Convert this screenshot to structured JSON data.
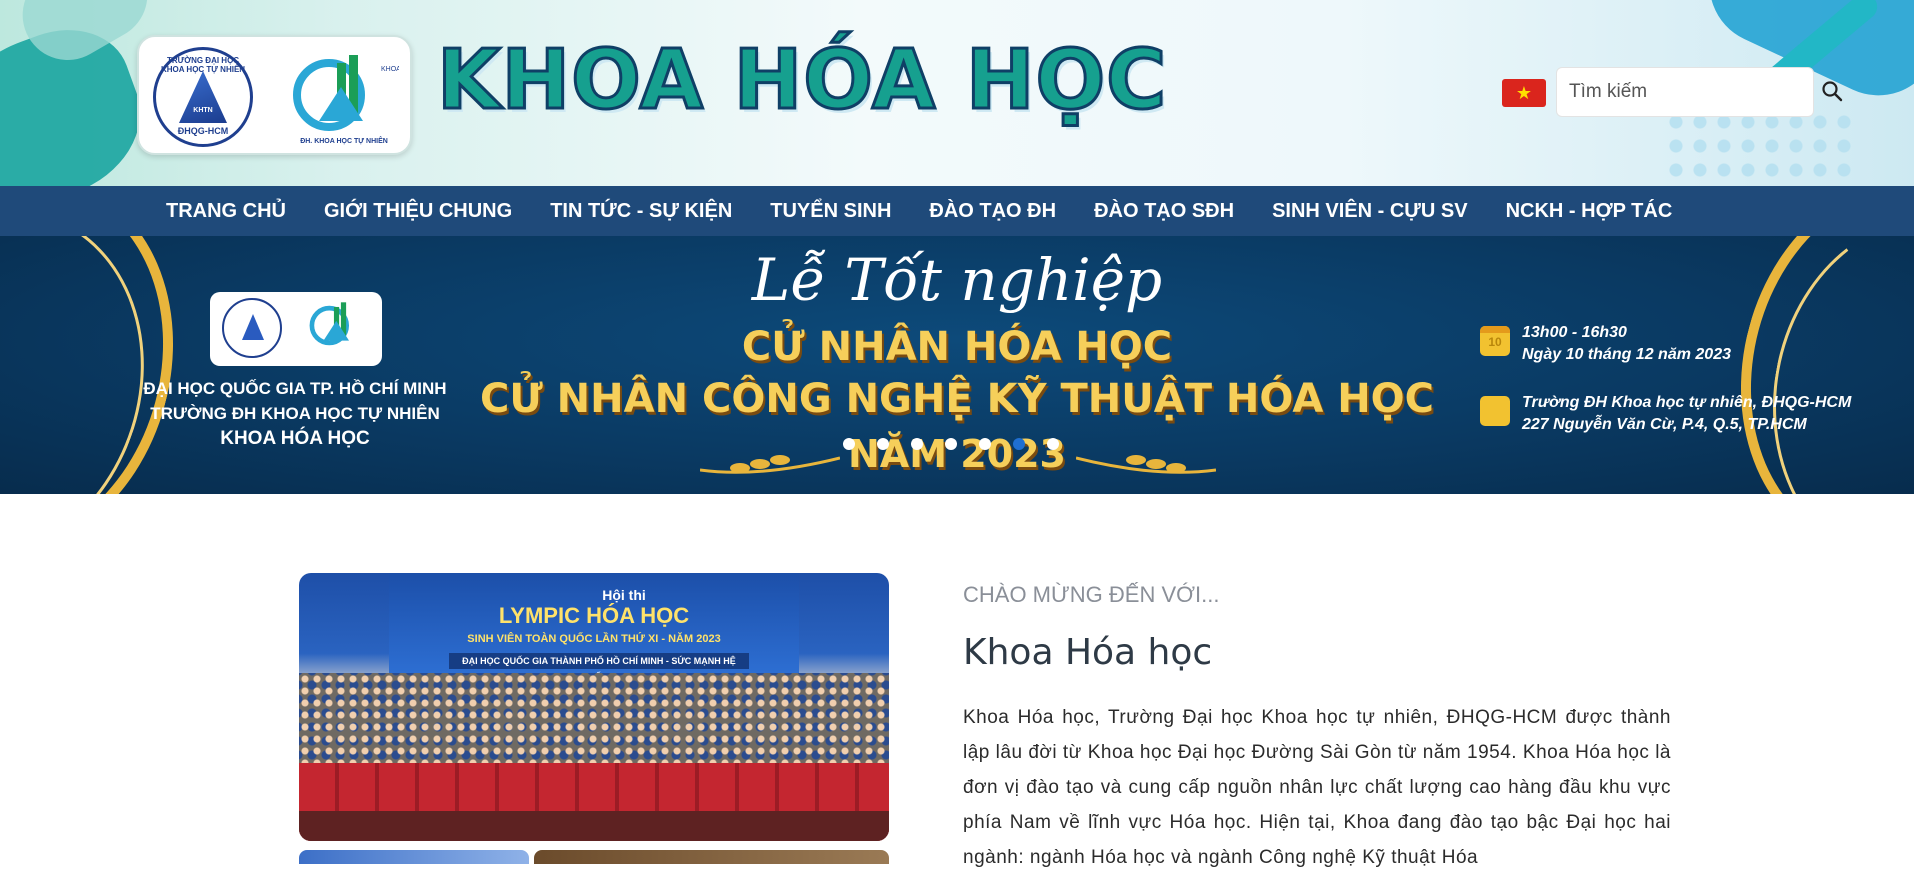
{
  "header": {
    "logo_seal_top": "TRƯỜNG ĐẠI HỌC KHOA HỌC TỰ NHIÊN",
    "logo_seal_mid": "KHTN",
    "logo_seal_bottom": "ĐHQG-HCM",
    "logo_mark_caption": "ĐH. KHOA HỌC TỰ NHIÊN",
    "site_title": "KHOA HÓA HỌC",
    "search_placeholder": "Tìm kiếm"
  },
  "nav": {
    "items": [
      {
        "label": "TRANG CHỦ"
      },
      {
        "label": "GIỚI THIỆU CHUNG"
      },
      {
        "label": "TIN TỨC - SỰ KIỆN"
      },
      {
        "label": "TUYỂN SINH"
      },
      {
        "label": "ĐÀO TẠO ĐH"
      },
      {
        "label": "ĐÀO TẠO SĐH"
      },
      {
        "label": "SINH VIÊN - CỰU SV"
      },
      {
        "label": "NCKH - HỢP TÁC"
      }
    ]
  },
  "banner": {
    "org_line1": "ĐẠI HỌC QUỐC GIA TP. HỒ CHÍ MINH",
    "org_line2": "TRƯỜNG ĐH KHOA HỌC TỰ NHIÊN",
    "org_line3": "KHOA HÓA HỌC",
    "script_title": "Lễ Tốt nghiệp",
    "line1": "CỬ NHÂN HÓA HỌC",
    "line2": "CỬ NHÂN CÔNG NGHỆ KỸ THUẬT HÓA HỌC",
    "line3": "NĂM 2023",
    "calendar_day": "10",
    "time": "13h00 - 16h30",
    "date": "Ngày 10 tháng 12 năm 2023",
    "place_line1": "Trường ĐH Khoa học tự nhiên, ĐHQG-HCM",
    "place_line2": "227 Nguyễn Văn Cừ, P.4, Q.5, TP.HCM",
    "slide_count": 7,
    "active_slide": 6
  },
  "photo": {
    "title_small": "Hội thi",
    "title_big": "LYMPIC HÓA HỌC",
    "subtitle": "SINH VIÊN TOÀN QUỐC LẦN THỨ XI - NĂM 2023",
    "strip": "ĐẠI HỌC QUỐC GIA THÀNH PHỐ HỒ CHÍ MINH - SỨC MẠNH HỆ THỐNG"
  },
  "welcome": {
    "eyebrow": "CHÀO MỪNG ĐẾN VỚI...",
    "heading": "Khoa Hóa học",
    "body": "Khoa Hóa học, Trường Đại học Khoa học tự nhiên, ĐHQG-HCM được thành lập lâu đời từ Khoa học Đại học Đường Sài Gòn từ năm 1954. Khoa Hóa học là đơn vị đào tạo và cung cấp nguồn nhân lực chất lượng cao hàng đầu khu vực phía Nam về lĩnh vực Hóa học. Hiện tại, Khoa đang đào tạo bậc Đại học hai ngành: ngành Hóa học và ngành Công nghệ Kỹ thuật Hóa"
  },
  "colors": {
    "nav_bg": "#1f4a7a",
    "banner_bg": "#0a3a63",
    "gold": "#f6cf5a",
    "title_teal": "#16a08f",
    "slider_active": "#1f6fd1"
  }
}
